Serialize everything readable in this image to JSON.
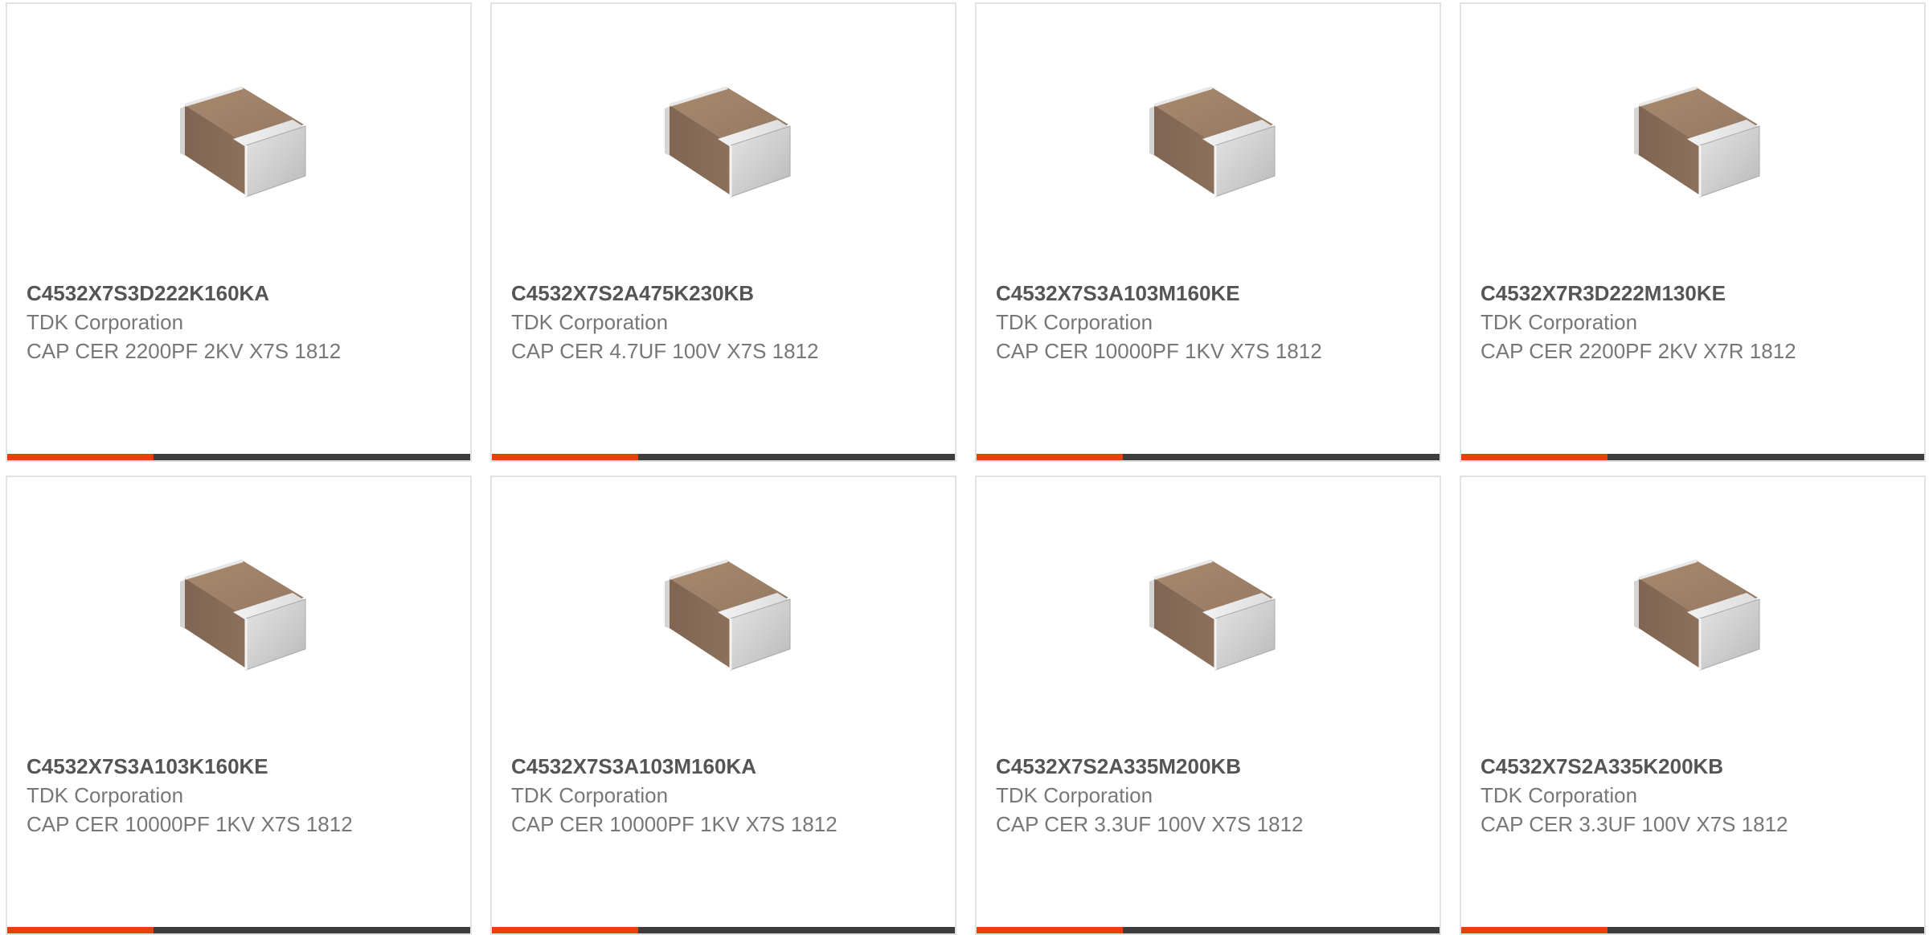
{
  "colors": {
    "accent": "#e8400c",
    "bar": "#3d3d3d",
    "part_number_text": "#555555",
    "secondary_text": "#777777",
    "card_border": "#e2e2e2"
  },
  "products": [
    {
      "icon": "ceramic-capacitor-chip-icon",
      "part_number": "C4532X7S3D222K160KA",
      "manufacturer": "TDK Corporation",
      "description": "CAP CER 2200PF 2KV X7S 1812"
    },
    {
      "icon": "ceramic-capacitor-chip-icon",
      "part_number": "C4532X7S2A475K230KB",
      "manufacturer": "TDK Corporation",
      "description": "CAP CER 4.7UF 100V X7S 1812"
    },
    {
      "icon": "ceramic-capacitor-chip-icon",
      "part_number": "C4532X7S3A103M160KE",
      "manufacturer": "TDK Corporation",
      "description": "CAP CER 10000PF 1KV X7S 1812"
    },
    {
      "icon": "ceramic-capacitor-chip-icon",
      "part_number": "C4532X7R3D222M130KE",
      "manufacturer": "TDK Corporation",
      "description": "CAP CER 2200PF 2KV X7R 1812"
    },
    {
      "icon": "ceramic-capacitor-chip-icon",
      "part_number": "C4532X7S3A103K160KE",
      "manufacturer": "TDK Corporation",
      "description": "CAP CER 10000PF 1KV X7S 1812"
    },
    {
      "icon": "ceramic-capacitor-chip-icon",
      "part_number": "C4532X7S3A103M160KA",
      "manufacturer": "TDK Corporation",
      "description": "CAP CER 10000PF 1KV X7S 1812"
    },
    {
      "icon": "ceramic-capacitor-chip-icon",
      "part_number": "C4532X7S2A335M200KB",
      "manufacturer": "TDK Corporation",
      "description": "CAP CER 3.3UF 100V X7S 1812"
    },
    {
      "icon": "ceramic-capacitor-chip-icon",
      "part_number": "C4532X7S2A335K200KB",
      "manufacturer": "TDK Corporation",
      "description": "CAP CER 3.3UF 100V X7S 1812"
    }
  ]
}
